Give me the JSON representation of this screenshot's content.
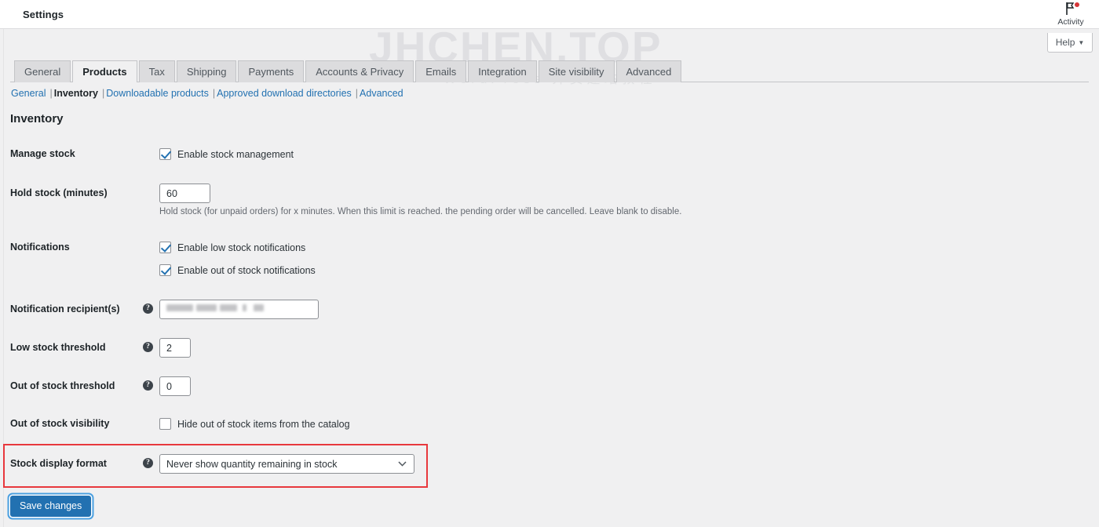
{
  "window": {
    "title": "Settings"
  },
  "watermark": {
    "text": "JHCHEN.TOP",
    "subtext": "WordPress 外贸建站教程"
  },
  "topright": {
    "activity_label": "Activity",
    "activity_icon": "flag-icon",
    "has_notification_dot": true,
    "help_label": "Help",
    "help_caret": "▼"
  },
  "tabs": [
    {
      "label": "General",
      "active": false
    },
    {
      "label": "Products",
      "active": true
    },
    {
      "label": "Tax",
      "active": false
    },
    {
      "label": "Shipping",
      "active": false
    },
    {
      "label": "Payments",
      "active": false
    },
    {
      "label": "Accounts & Privacy",
      "active": false
    },
    {
      "label": "Emails",
      "active": false
    },
    {
      "label": "Integration",
      "active": false
    },
    {
      "label": "Site visibility",
      "active": false
    },
    {
      "label": "Advanced",
      "active": false
    }
  ],
  "subnav": {
    "items": [
      {
        "label": "General",
        "current": false
      },
      {
        "label": "Inventory",
        "current": true
      },
      {
        "label": "Downloadable products",
        "current": false
      },
      {
        "label": "Approved download directories",
        "current": false
      },
      {
        "label": "Advanced",
        "current": false
      }
    ],
    "separator": "|"
  },
  "section": {
    "title": "Inventory"
  },
  "fields": {
    "manage_stock": {
      "label": "Manage stock",
      "checkbox_label": "Enable stock management",
      "checked": true
    },
    "hold_stock": {
      "label": "Hold stock (minutes)",
      "value": "60",
      "helper": "Hold stock (for unpaid orders) for x minutes. When this limit is reached. the pending order will be cancelled. Leave blank to disable."
    },
    "notifications": {
      "label": "Notifications",
      "low_stock_label": "Enable low stock notifications",
      "low_stock_checked": true,
      "out_of_stock_label": "Enable out of stock notifications",
      "out_of_stock_checked": true
    },
    "notification_recipients": {
      "label": "Notification recipient(s)",
      "value": "",
      "redacted": true,
      "help_icon": "question-mark-icon"
    },
    "low_stock_threshold": {
      "label": "Low stock threshold",
      "value": "2",
      "help_icon": "question-mark-icon"
    },
    "out_of_stock_threshold": {
      "label": "Out of stock threshold",
      "value": "0",
      "help_icon": "question-mark-icon"
    },
    "out_of_stock_visibility": {
      "label": "Out of stock visibility",
      "checkbox_label": "Hide out of stock items from the catalog",
      "checked": false
    },
    "stock_display_format": {
      "label": "Stock display format",
      "value": "Never show quantity remaining in stock",
      "help_icon": "question-mark-icon",
      "caret": "⌄",
      "highlighted": true,
      "highlight_color": "#e8383d"
    }
  },
  "actions": {
    "save_label": "Save changes"
  }
}
